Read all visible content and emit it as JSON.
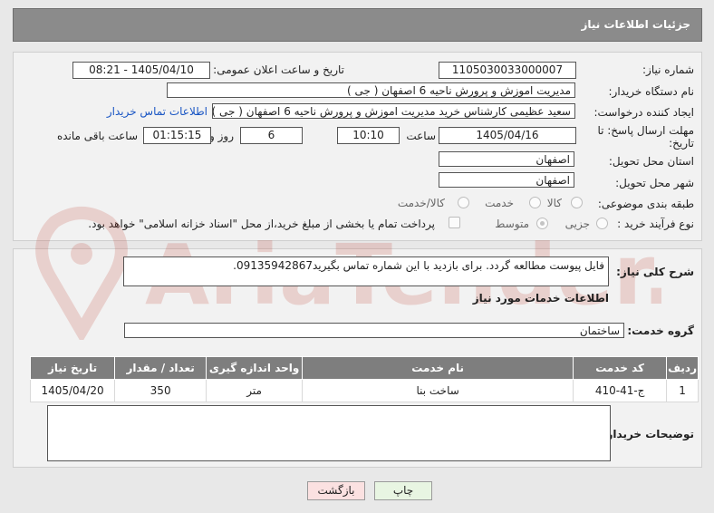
{
  "header": {
    "title": "جزئیات اطلاعات نیاز"
  },
  "fields": {
    "need_number_label": "شماره نیاز:",
    "need_number": "1105030033000007",
    "announce_label": "تاریخ و ساعت اعلان عمومی:",
    "announce_value": "1405/04/10 - 08:21",
    "buyer_org_label": "نام دستگاه خریدار:",
    "buyer_org": "مدیریت اموزش و پرورش ناحیه 6 اصفهان ( جی )",
    "creator_label": "ایجاد کننده درخواست:",
    "creator": "سعید عظیمی کارشناس خرید مدیریت اموزش و پرورش ناحیه 6 اصفهان ( جی )",
    "contact_link": "اطلاعات تماس خریدار",
    "deadline_label_1": "مهلت ارسال پاسخ: تا",
    "deadline_label_2": "تاریخ:",
    "deadline_date": "1405/04/16",
    "time_label": "ساعت",
    "deadline_time": "10:10",
    "days_value": "6",
    "days_label": "روز و",
    "remaining_time": "01:15:15",
    "remaining_label": "ساعت باقی مانده",
    "province_label": "استان محل تحویل:",
    "province": "اصفهان",
    "city_label": "شهر محل تحویل:",
    "city": "اصفهان",
    "category_label": "طبقه بندی موضوعی:",
    "category_options": [
      "کالا",
      "خدمت",
      "کالا/خدمت"
    ],
    "purchase_type_label": "نوع فرآیند خرید :",
    "purchase_options": [
      "جزیی",
      "متوسط"
    ],
    "payment_note": "پرداخت تمام یا بخشی از مبلغ خرید،از محل \"اسناد خزانه اسلامی\" خواهد بود."
  },
  "description": {
    "label": "شرح کلی نیاز:",
    "text": "فایل پیوست مطالعه گردد. برای بازدید با این شماره تماس بگیرید09135942867."
  },
  "services": {
    "section_title": "اطلاعات خدمات مورد نیاز",
    "group_label": "گروه خدمت:",
    "group_value": "ساختمان",
    "columns": [
      "ردیف",
      "کد خدمت",
      "نام خدمت",
      "واحد اندازه گیری",
      "تعداد / مقدار",
      "تاریخ نیاز"
    ],
    "rows": [
      [
        "1",
        "ج-41-410",
        "ساخت بنا",
        "متر",
        "350",
        "1405/04/20"
      ]
    ]
  },
  "buyer_notes": {
    "label": "توضیحات خریدار:",
    "text": ""
  },
  "buttons": {
    "print": "چاپ",
    "back": "بازگشت"
  },
  "watermark_text": "AriaTender.net"
}
